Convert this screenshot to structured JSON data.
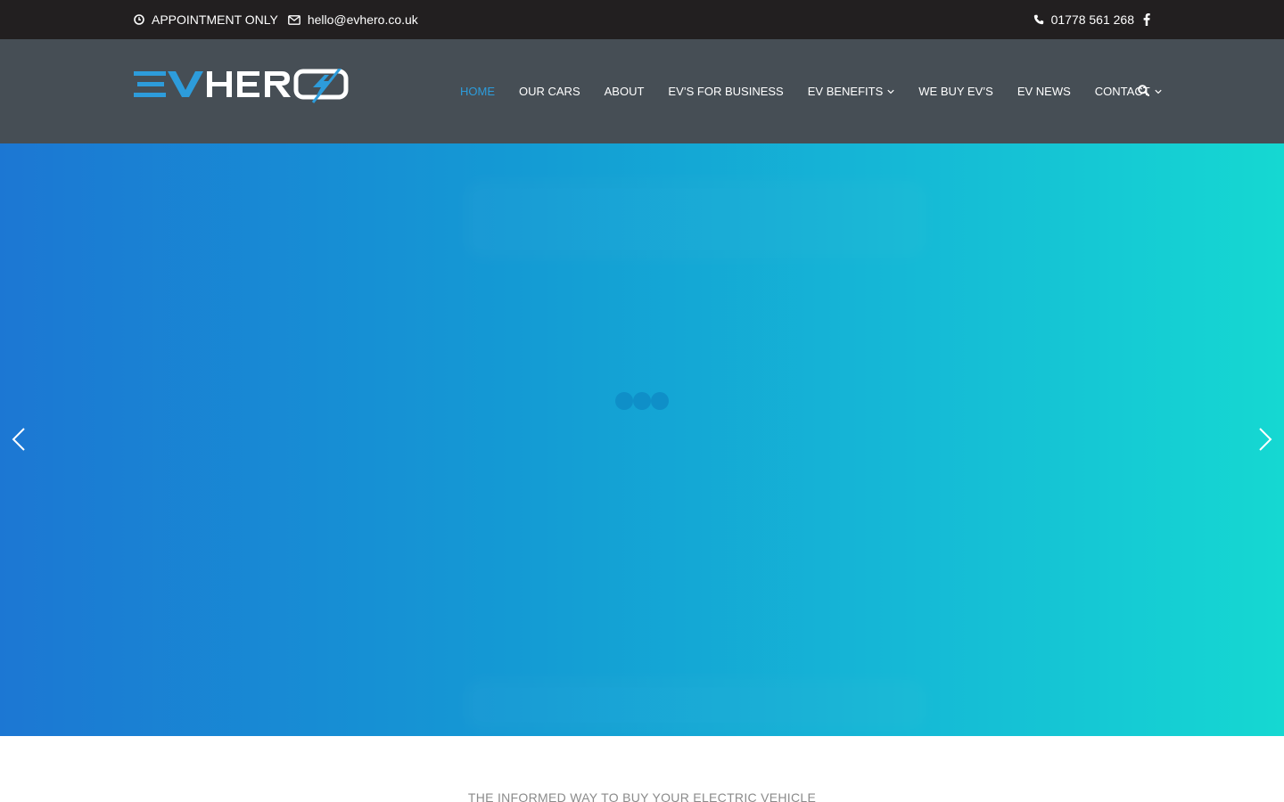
{
  "topbar": {
    "hours_icon": "clock-icon",
    "hours": "APPOINTMENT ONLY",
    "email_icon": "envelope-icon",
    "email": "hello@evhero.co.uk",
    "phone_icon": "phone-icon",
    "phone": "01778 561 268",
    "social_icon": "facebook-icon"
  },
  "logo": {
    "part1": "EV",
    "part2": "HER",
    "part3": "O"
  },
  "nav": {
    "items": [
      {
        "label": "HOME",
        "active": true
      },
      {
        "label": "OUR CARS"
      },
      {
        "label": "ABOUT"
      },
      {
        "label": "EV’S FOR BUSINESS"
      },
      {
        "label": "EV BENEFITS",
        "dropdown": true
      },
      {
        "label": "WE BUY EV’S"
      },
      {
        "label": "EV NEWS"
      },
      {
        "label": "CONTACT",
        "dropdown": true
      }
    ],
    "search_icon": "search-icon"
  },
  "hero": {
    "prev_icon": "chevron-left-icon",
    "next_icon": "chevron-right-icon",
    "loader_icon": "loading-dots-icon"
  },
  "intro": {
    "tagline": "THE INFORMED WAY TO BUY YOUR ELECTRIC VEHICLE"
  },
  "colors": {
    "topbar_bg": "#221f20",
    "header_bg": "#464e55",
    "accent": "#2d9cdb",
    "hero_start": "#1c77d3",
    "hero_end": "#15d8d2"
  }
}
